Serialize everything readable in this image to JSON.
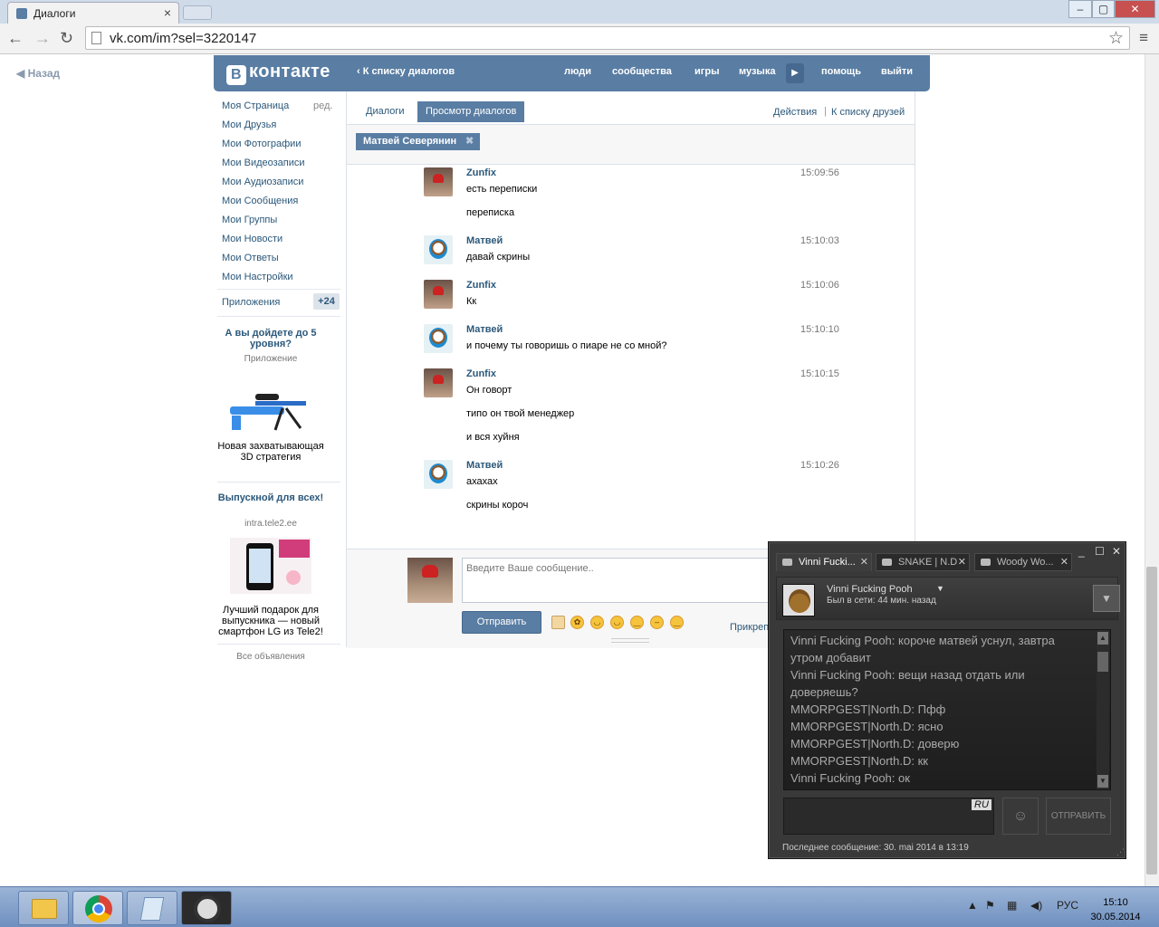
{
  "browser": {
    "tab_title": "Диалоги",
    "url": "vk.com/im?sel=3220147"
  },
  "vk": {
    "back": "Назад",
    "logo": "контакте",
    "logo_letter": "В",
    "header_back": "К списку диалогов",
    "nav": [
      "люди",
      "сообщества",
      "игры",
      "музыка",
      "помощь",
      "выйти"
    ],
    "left_nav": [
      "Моя Страница",
      "Мои Друзья",
      "Мои Фотографии",
      "Мои Видеозаписи",
      "Мои Аудиозаписи",
      "Мои Сообщения",
      "Мои Группы",
      "Мои Новости",
      "Мои Ответы",
      "Мои Настройки"
    ],
    "edit": "ред.",
    "apps": "Приложения",
    "apps_badge": "+24",
    "ad1": {
      "title": "А вы дойдете до 5 уровня?",
      "sub": "Приложение",
      "body": "Новая захватывающая 3D стратегия"
    },
    "ad2": {
      "title": "Выпускной для всех!",
      "sub": "intra.tele2.ee",
      "body": "Лучший подарок для выпускника — новый смартфон LG из Tele2!"
    },
    "ads_all": "Все объявления",
    "tabs": {
      "dialogs": "Диалоги",
      "view": "Просмотр диалогов"
    },
    "actions": "Действия",
    "to_friends": "К списку друзей",
    "chip": "Матвей Северянин",
    "messages": [
      {
        "name": "Zunfix",
        "time": "15:09:56",
        "lines": [
          "есть переписки",
          "переписка"
        ]
      },
      {
        "name": "Матвей",
        "time": "15:10:03",
        "lines": [
          "давай скрины"
        ]
      },
      {
        "name": "Zunfix",
        "time": "15:10:06",
        "lines": [
          "Кк"
        ]
      },
      {
        "name": "Матвей",
        "time": "15:10:10",
        "lines": [
          "и почему ты говоришь о пиаре не со мной?"
        ]
      },
      {
        "name": "Zunfix",
        "time": "15:10:15",
        "lines": [
          "Он говорт",
          "типо он твой менеджер",
          "и вся хуйня"
        ]
      },
      {
        "name": "Матвей",
        "time": "15:10:26",
        "lines": [
          "ахахах",
          "скрины короч"
        ]
      }
    ],
    "input_placeholder": "Введите Ваше сообщение..",
    "send": "Отправить",
    "attach": "Прикреп"
  },
  "steam": {
    "tabs": [
      "Vinni Fucki...",
      "SNAKE | N.D",
      "Woody Wo..."
    ],
    "name": "Vinni Fucking Pooh",
    "status": "Был в сети: 44 мин. назад",
    "log": [
      "Vinni Fucking Pooh: короче матвей уснул, завтра",
      "утром добавит",
      "Vinni Fucking Pooh: вещи назад отдать или",
      "доверяешь?",
      "MMORPGEST|North.D: Пфф",
      "MMORPGEST|North.D: ясно",
      "MMORPGEST|North.D: доверю",
      "MMORPGEST|North.D: кк",
      "Vinni Fucking Pooh: ок"
    ],
    "lang": "RU",
    "send": "ОТПРАВИТЬ",
    "last": "Последнее сообщение: 30. mai 2014 в 13:19"
  },
  "taskbar": {
    "lang": "РУС",
    "time": "15:10",
    "date": "30.05.2014"
  }
}
